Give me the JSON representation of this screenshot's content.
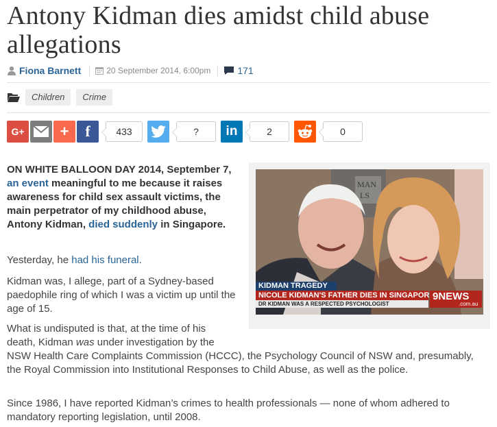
{
  "article": {
    "title": "Antony Kidman dies amidst child abuse allegations",
    "author": "Fiona Barnett",
    "date": "20 September 2014, 6:00pm",
    "comments_count": "171",
    "categories": [
      "Children",
      "Crime"
    ]
  },
  "share": {
    "googleplus_label": "G+",
    "plus_label": "+",
    "facebook_label": "f",
    "facebook_count": "433",
    "twitter_count": "?",
    "linkedin_label": "in",
    "linkedin_count": "2",
    "reddit_count": "0",
    "colors": {
      "googleplus": "#dc4e41",
      "email": "#7d7d7d",
      "plus": "#f8694d",
      "facebook": "#3b5998",
      "twitter": "#55acee",
      "linkedin": "#0077b5",
      "reddit": "#ff5700"
    }
  },
  "body": {
    "lede_1": "ON WHITE BALLOON DAY 2014, September 7, ",
    "lede_link_1": "an event",
    "lede_2": " meaningful to me because it raises awareness for child sex assault victims, the main perpetrator of my childhood abuse, Antony Kidman, ",
    "lede_link_2": "died suddenly",
    "lede_3": " in Singapore.",
    "p1_a": "Yesterday, he ",
    "p1_link": "had his funeral",
    "p1_b": ".",
    "p2": "Kidman was, I allege, part of a Sydney-based paedophile ring of which I was a victim up until the age of 15.",
    "p3_a": "What is undisputed is that, at the time of his death, Kidman ",
    "p3_em": "was",
    "p3_b": " under investigation by the",
    "p3_c": "NSW Health Care Complaints Commission (HCCC), the Psychology Council of NSW and, presumably, the Royal Commission into Institutional Responses to Child Abuse, as well as the police.",
    "p4": "Since 1986, I have reported Kidman’s crimes to health professionals — none of whom adhered to mandatory reporting legislation, until 2008."
  },
  "image": {
    "bg_text": "MAN\nLS",
    "caption_top": "KIDMAN TRAGEDY",
    "caption_main": "NICOLE KIDMAN'S FATHER DIES IN SINGAPORE",
    "caption_sub": "DR KIDMAN WAS A RESPECTED PSYCHOLOGIST",
    "network": "9NEWS",
    "network_sub": ".com.au"
  }
}
